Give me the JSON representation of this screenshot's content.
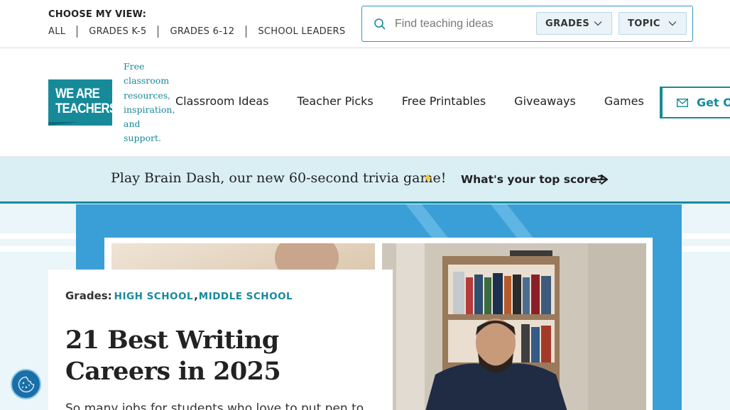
{
  "utility": {
    "view_title": "CHOOSE MY VIEW:",
    "view_links": [
      "ALL",
      "GRADES K-5",
      "GRADES 6-12",
      "SCHOOL LEADERS"
    ]
  },
  "search": {
    "placeholder": "Find teaching ideas",
    "icon": "search-icon",
    "filters": [
      "GRADES",
      "TOPIC"
    ]
  },
  "brand": {
    "logo_line1": "WE ARE",
    "logo_line2": "TEACHERS",
    "tagline": "Free classroom resources, inspiration, and support.",
    "color": "#178a9a"
  },
  "nav": {
    "items": [
      "Classroom Ideas",
      "Teacher Picks",
      "Free Printables",
      "Giveaways",
      "Games"
    ],
    "cta_label": "Get Ou",
    "cta_icon": "mail-icon"
  },
  "promo": {
    "text": "Play Brain Dash, our new 60-second trivia game!",
    "link": "What's your top score?",
    "icons": [
      "star-icon",
      "arrow-right-icon"
    ]
  },
  "article": {
    "grades_label": "Grades:",
    "grades": [
      "HIGH SCHOOL",
      "MIDDLE SCHOOL"
    ],
    "grade_separator": ",",
    "title": "21 Best Writing Careers in 2025",
    "dek": "So many jobs for students who love to put pen to"
  },
  "colors": {
    "accent": "#178a9a",
    "hero_panel": "#3a9fd6",
    "promo_bg": "#d9eff4"
  }
}
